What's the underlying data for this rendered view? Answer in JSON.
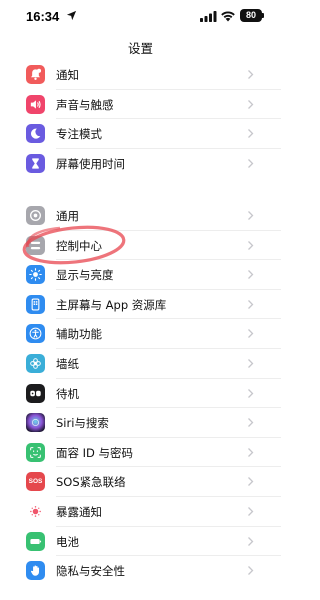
{
  "status": {
    "time": "16:34",
    "battery": "80"
  },
  "nav": {
    "title": "设置"
  },
  "group1": [
    {
      "label": "通知",
      "icon": "bell-icon",
      "color": "#f15b5b"
    },
    {
      "label": "声音与触感",
      "icon": "speaker-icon",
      "color": "#f0456b"
    },
    {
      "label": "专注模式",
      "icon": "moon-icon",
      "color": "#6a5be0"
    },
    {
      "label": "屏幕使用时间",
      "icon": "hourglass-icon",
      "color": "#6a5be0"
    }
  ],
  "group2": [
    {
      "label": "通用",
      "icon": "gear-icon",
      "color": "#a7a7ad"
    },
    {
      "label": "控制中心",
      "icon": "sliders-icon",
      "color": "#a7a7ad"
    },
    {
      "label": "显示与亮度",
      "icon": "sun-icon",
      "color": "#2f8cf0"
    },
    {
      "label": "主屏幕与 App 资源库",
      "icon": "grid-icon",
      "color": "#2f8cf0"
    },
    {
      "label": "辅助功能",
      "icon": "accessibility-icon",
      "color": "#2f8cf0"
    },
    {
      "label": "墙纸",
      "icon": "flower-icon",
      "color": "#3aaed8"
    },
    {
      "label": "待机",
      "icon": "standby-icon",
      "color": "#1c1c1e"
    },
    {
      "label": "Siri与搜索",
      "icon": "siri-icon",
      "color": "#3a2a6e"
    },
    {
      "label": "面容 ID 与密码",
      "icon": "faceid-icon",
      "color": "#38c172"
    },
    {
      "label": "SOS紧急联络",
      "icon": "sos-icon",
      "color": "#e5484d"
    },
    {
      "label": "暴露通知",
      "icon": "exposure-icon",
      "color": "#ffffff"
    },
    {
      "label": "电池",
      "icon": "battery-icon",
      "color": "#38c172"
    },
    {
      "label": "隐私与安全性",
      "icon": "hand-icon",
      "color": "#2f8cf0"
    }
  ],
  "sos_text": "SOS"
}
